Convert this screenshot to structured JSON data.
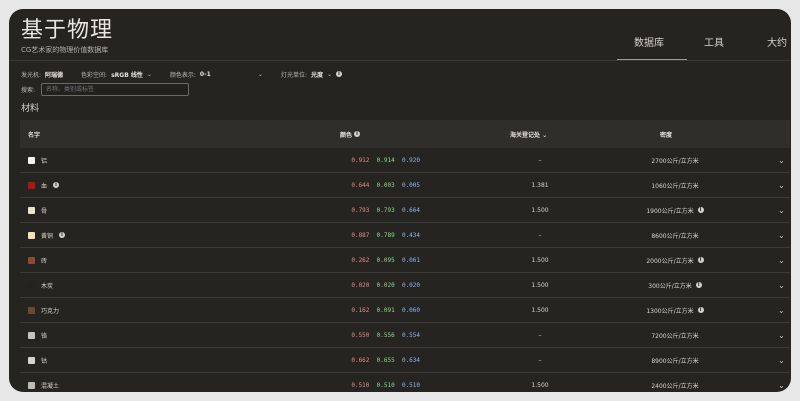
{
  "header": {
    "title": "基于物理",
    "subtitle": "CG艺术家的物理价值数据库",
    "nav": [
      "数据库",
      "工具",
      "大约"
    ]
  },
  "controls": {
    "illuminant_label": "发光机:",
    "illuminant_value": "阿瑞德",
    "colorspace_label": "色彩空间:",
    "colorspace_value": "sRGB 线性",
    "color_repr_label": "颜色表示:",
    "color_repr_value": "0-1",
    "light_unit_label": "灯光单位:",
    "light_unit_value": "光度"
  },
  "search": {
    "label": "搜索:",
    "placeholder": "名称、类别或标签"
  },
  "section_title": "材料",
  "table": {
    "headers": {
      "name": "名字",
      "color": "颜色",
      "ior": "海关登记处",
      "density": "密度"
    },
    "rows": [
      {
        "name": "铝",
        "swatch": "#f2f2f2",
        "r": "0.912",
        "g": "0.914",
        "b": "0.920",
        "ior": "–",
        "density": "2700公斤/立方米",
        "info": false
      },
      {
        "name": "血",
        "swatch": "#b01515",
        "r": "0.644",
        "g": "0.003",
        "b": "0.005",
        "ior": "1.381",
        "density": "1060公斤/立方米",
        "info": false,
        "name_info": true
      },
      {
        "name": "骨",
        "swatch": "#eae4cb",
        "r": "0.793",
        "g": "0.793",
        "b": "0.664",
        "ior": "1.500",
        "density": "1900公斤/立方米",
        "info": true
      },
      {
        "name": "黄铜",
        "swatch": "#f1e3b4",
        "r": "0.887",
        "g": "0.789",
        "b": "0.434",
        "ior": "–",
        "density": "8600公斤/立方米",
        "info": false,
        "name_info": true
      },
      {
        "name": "砖",
        "swatch": "#8d4b32",
        "r": "0.262",
        "g": "0.095",
        "b": "0.061",
        "ior": "1.500",
        "density": "2000公斤/立方米",
        "info": true
      },
      {
        "name": "木炭",
        "swatch": "#232220",
        "r": "0.020",
        "g": "0.020",
        "b": "0.020",
        "ior": "1.500",
        "density": "300公斤/立方米",
        "info": true
      },
      {
        "name": "巧克力",
        "swatch": "#6a4a36",
        "r": "0.162",
        "g": "0.091",
        "b": "0.060",
        "ior": "1.500",
        "density": "1300公斤/立方米",
        "info": true
      },
      {
        "name": "铬",
        "swatch": "#c6c4be",
        "r": "0.550",
        "g": "0.556",
        "b": "0.554",
        "ior": "–",
        "density": "7200公斤/立方米",
        "info": false
      },
      {
        "name": "钴",
        "swatch": "#d5d4cc",
        "r": "0.662",
        "g": "0.655",
        "b": "0.634",
        "ior": "–",
        "density": "8900公斤/立方米",
        "info": false
      },
      {
        "name": "混凝土",
        "swatch": "#bcbcbc",
        "r": "0.510",
        "g": "0.510",
        "b": "0.510",
        "ior": "1.500",
        "density": "2400公斤/立方米",
        "info": false
      }
    ]
  }
}
